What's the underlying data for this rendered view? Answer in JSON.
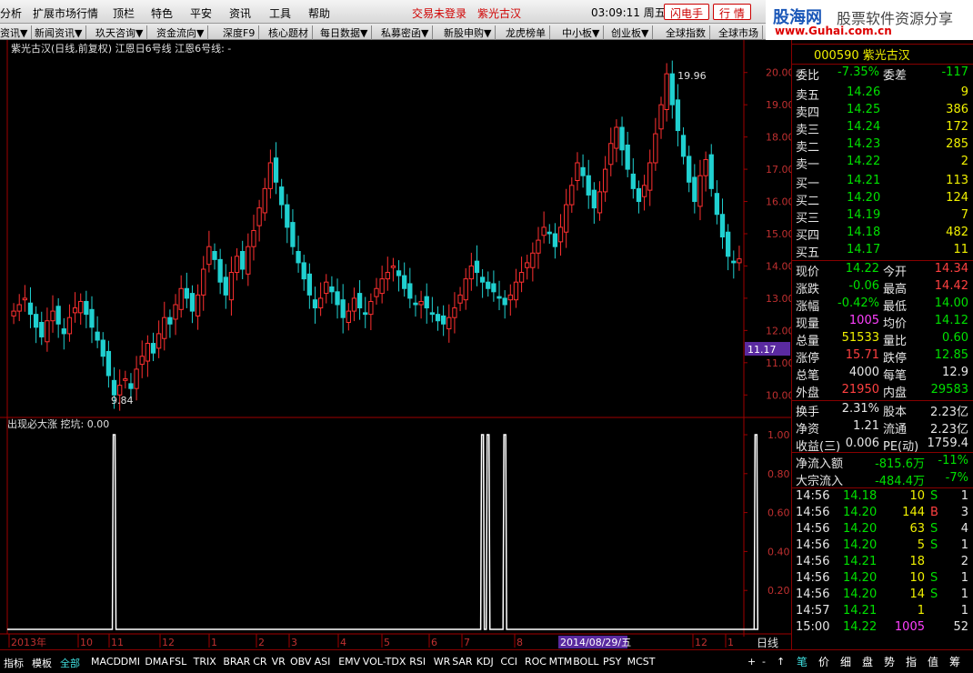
{
  "menu": {
    "items": [
      "分析",
      "扩展市场行情",
      "顶栏",
      "特色",
      "平安",
      "资讯",
      "工具",
      "帮助"
    ],
    "status1": "交易未登录",
    "status2": "紫光古汉",
    "clock": "03:09:11 周五",
    "btn_flash": "闪电手",
    "btn_quote": "行 情"
  },
  "logo": {
    "brand": "股海网",
    "tagline": "股票软件资源分享",
    "url": "www.Guhai.com.cn"
  },
  "tabs": [
    "资讯▼",
    "新闻资讯▼",
    "玖天咨询▼",
    "资金流向▼",
    "深度F9",
    "核心题材",
    "每日数据▼",
    "私募密函▼",
    "新股申购▼",
    "龙虎榜单",
    "中小板▼",
    "创业板▼",
    "全球指数",
    "全球市场"
  ],
  "chart_title": "紫光古汉(日线,前复权) 江恩日6号线 江恩6号线: -",
  "sub_title": "出现必大涨 挖坑: 0.00",
  "cursor_price": "11.17",
  "period": "日线",
  "date_label": "2014/08/29/五",
  "chart_data": [
    {
      "type": "candlestick",
      "title": "紫光古汉(日线,前复权) 江恩日6号线 江恩6号线: -",
      "ylim": [
        9.5,
        20.5
      ],
      "yticks": [
        "20.00",
        "19.00",
        "18.00",
        "17.00",
        "16.00",
        "15.00",
        "14.00",
        "13.00",
        "12.00",
        "11.00",
        "10.00"
      ],
      "xticks": [
        "2013年",
        "10",
        "11",
        "12",
        "1",
        "2",
        "3",
        "4",
        "5",
        "6",
        "7",
        "8",
        "2014/08/29/五",
        "12",
        "1"
      ],
      "annotations": [
        {
          "text": "19.96",
          "value": 19.96
        },
        {
          "text": "9.84",
          "value": 9.84
        }
      ],
      "close": [
        12.6,
        12.8,
        13.0,
        12.5,
        12.1,
        11.8,
        12.3,
        12.6,
        12.2,
        11.9,
        12.4,
        12.7,
        12.9,
        12.5,
        12.1,
        11.7,
        11.2,
        10.6,
        10.0,
        10.3,
        10.5,
        10.2,
        10.8,
        11.2,
        11.6,
        11.3,
        11.9,
        12.4,
        12.2,
        12.8,
        13.3,
        13.0,
        12.6,
        13.1,
        13.9,
        14.6,
        14.2,
        13.5,
        13.1,
        13.8,
        14.3,
        13.9,
        14.6,
        15.1,
        15.8,
        16.4,
        17.2,
        16.6,
        15.9,
        15.2,
        14.6,
        14.1,
        13.6,
        13.1,
        12.7,
        13.0,
        13.5,
        13.2,
        12.8,
        12.4,
        12.6,
        13.0,
        12.7,
        12.5,
        12.9,
        13.3,
        13.6,
        13.8,
        14.0,
        13.7,
        13.3,
        13.0,
        12.8,
        12.9,
        12.7,
        12.5,
        12.3,
        12.2,
        12.4,
        12.7,
        13.1,
        13.6,
        14.0,
        13.8,
        13.5,
        13.3,
        13.2,
        13.0,
        12.8,
        13.1,
        13.5,
        13.8,
        14.1,
        14.4,
        14.8,
        15.2,
        15.0,
        14.6,
        15.2,
        15.9,
        16.5,
        17.2,
        16.8,
        16.2,
        15.8,
        16.3,
        17.0,
        17.8,
        18.3,
        17.6,
        17.0,
        16.4,
        16.0,
        16.5,
        17.2,
        18.1,
        19.0,
        19.96,
        19.0,
        18.2,
        17.4,
        16.6,
        16.0,
        16.8,
        17.3,
        16.4,
        15.6,
        14.9,
        14.3,
        14.1,
        14.22
      ],
      "sma": [
        12.6,
        12.7,
        12.8,
        12.7,
        12.6,
        12.4,
        12.4,
        12.3,
        12.2,
        12.1,
        12.2,
        12.3,
        12.4,
        12.4,
        12.3,
        12.1,
        11.9,
        11.6,
        11.3,
        11.0,
        10.8,
        10.6,
        10.5,
        10.6,
        10.8,
        10.9,
        11.1,
        11.4,
        11.7,
        12.0,
        12.3,
        12.5,
        12.6,
        12.8,
        13.1,
        13.4,
        13.6,
        13.7,
        13.7,
        13.8,
        13.9,
        14.0,
        14.2,
        14.4,
        14.8,
        15.2,
        15.6,
        15.8,
        15.8,
        15.7,
        15.5,
        15.1,
        14.7,
        14.2,
        13.8,
        13.5,
        13.3,
        13.2,
        13.1,
        12.9,
        12.8,
        12.8,
        12.8,
        12.7,
        12.7,
        12.8,
        13.0,
        13.2,
        13.4,
        13.5,
        13.5,
        13.4,
        13.2,
        13.0,
        12.9,
        12.8,
        12.6,
        12.5,
        12.4,
        12.4,
        12.6,
        12.8,
        13.1,
        13.3,
        13.4,
        13.5,
        13.5,
        13.4,
        13.3,
        13.2,
        13.3,
        13.4,
        13.6,
        13.8,
        14.1,
        14.4,
        14.6,
        14.8,
        15.0,
        15.3,
        15.6,
        16.0,
        16.3,
        16.5,
        16.6,
        16.7,
        16.8,
        17.0,
        17.3,
        17.4,
        17.4,
        17.2,
        17.0,
        16.9,
        16.9,
        17.2,
        17.6,
        18.1,
        18.4,
        18.5,
        18.3,
        18.0,
        17.6,
        17.3,
        17.1,
        16.9,
        16.6,
        16.2,
        15.7,
        15.2,
        14.8
      ]
    },
    {
      "type": "line",
      "title": "出现必大涨 挖坑: 0.00",
      "ylim": [
        0,
        1
      ],
      "yticks": [
        "1.00",
        "0.80",
        "0.60",
        "0.40",
        "0.20"
      ],
      "signal_index": [
        18,
        84,
        85,
        88,
        133
      ]
    }
  ],
  "quote": {
    "code": "000590 紫光古汉",
    "weibi_label": "委比",
    "weibi": "-7.35%",
    "weicha_label": "委差",
    "weicha": "-117",
    "asks": [
      {
        "l": "卖五",
        "p": "14.26",
        "v": "9"
      },
      {
        "l": "卖四",
        "p": "14.25",
        "v": "386"
      },
      {
        "l": "卖三",
        "p": "14.24",
        "v": "172"
      },
      {
        "l": "卖二",
        "p": "14.23",
        "v": "285"
      },
      {
        "l": "卖一",
        "p": "14.22",
        "v": "2"
      }
    ],
    "bids": [
      {
        "l": "买一",
        "p": "14.21",
        "v": "113"
      },
      {
        "l": "买二",
        "p": "14.20",
        "v": "124"
      },
      {
        "l": "买三",
        "p": "14.19",
        "v": "7"
      },
      {
        "l": "买四",
        "p": "14.18",
        "v": "482"
      },
      {
        "l": "买五",
        "p": "14.17",
        "v": "11"
      }
    ],
    "stats": [
      {
        "a": "现价",
        "av": "14.22",
        "ac": "c-g",
        "b": "今开",
        "bv": "14.34",
        "bc": "c-r"
      },
      {
        "a": "涨跌",
        "av": "-0.06",
        "ac": "c-g",
        "b": "最高",
        "bv": "14.42",
        "bc": "c-r"
      },
      {
        "a": "涨幅",
        "av": "-0.42%",
        "ac": "c-g",
        "b": "最低",
        "bv": "14.00",
        "bc": "c-g"
      },
      {
        "a": "现量",
        "av": "1005",
        "ac": "c-p",
        "b": "均价",
        "bv": "14.12",
        "bc": "c-g"
      },
      {
        "a": "总量",
        "av": "51533",
        "ac": "c-y",
        "b": "量比",
        "bv": "0.60",
        "bc": "c-g"
      },
      {
        "a": "涨停",
        "av": "15.71",
        "ac": "c-r",
        "b": "跌停",
        "bv": "12.85",
        "bc": "c-g"
      },
      {
        "a": "总笔",
        "av": "4000",
        "ac": "c-w",
        "b": "每笔",
        "bv": "12.9",
        "bc": "c-w"
      },
      {
        "a": "外盘",
        "av": "21950",
        "ac": "c-r",
        "b": "内盘",
        "bv": "29583",
        "bc": "c-g"
      }
    ],
    "stats2": [
      {
        "a": "换手",
        "av": "2.31%",
        "b": "股本",
        "bv": "2.23亿"
      },
      {
        "a": "净资",
        "av": "1.21",
        "b": "流通",
        "bv": "2.23亿"
      },
      {
        "a": "收益(三)",
        "av": "0.006",
        "b": "PE(动)",
        "bv": "1759.4"
      }
    ],
    "flow": [
      {
        "a": "净流入额",
        "av": "-815.6万",
        "bv": "-11%"
      },
      {
        "a": "大宗流入",
        "av": "-484.4万",
        "bv": "-7%"
      }
    ],
    "ticks": [
      {
        "t": "14:56",
        "p": "14.18",
        "v": "10",
        "s": "S",
        "n": "1"
      },
      {
        "t": "14:56",
        "p": "14.20",
        "v": "144",
        "s": "B",
        "n": "3"
      },
      {
        "t": "14:56",
        "p": "14.20",
        "v": "63",
        "s": "S",
        "n": "4"
      },
      {
        "t": "14:56",
        "p": "14.20",
        "v": "5",
        "s": "S",
        "n": "1"
      },
      {
        "t": "14:56",
        "p": "14.21",
        "v": "18",
        "s": "",
        "n": "2"
      },
      {
        "t": "14:56",
        "p": "14.20",
        "v": "10",
        "s": "S",
        "n": "1"
      },
      {
        "t": "14:56",
        "p": "14.20",
        "v": "14",
        "s": "S",
        "n": "1"
      },
      {
        "t": "14:57",
        "p": "14.21",
        "v": "1",
        "s": "",
        "n": "1"
      },
      {
        "t": "15:00",
        "p": "14.22",
        "v": "1005",
        "s": "",
        "n": "52"
      }
    ]
  },
  "bottom": {
    "left": [
      "指标",
      "模板",
      "全部"
    ],
    "ind": [
      "MACD",
      "DMI",
      "DMA",
      "FSL",
      "TRIX",
      "BRAR",
      "CR",
      "VR",
      "OBV",
      "ASI",
      "EMV",
      "VOL-TDX",
      "RSI",
      "WR",
      "SAR",
      "KDJ",
      "CCI",
      "ROC",
      "MTM",
      "BOLL",
      "PSY",
      "MCST"
    ],
    "nav": [
      "+",
      "-",
      "↑"
    ],
    "side": [
      "笔",
      "价",
      "细",
      "盘",
      "势",
      "指",
      "值",
      "筹"
    ]
  }
}
